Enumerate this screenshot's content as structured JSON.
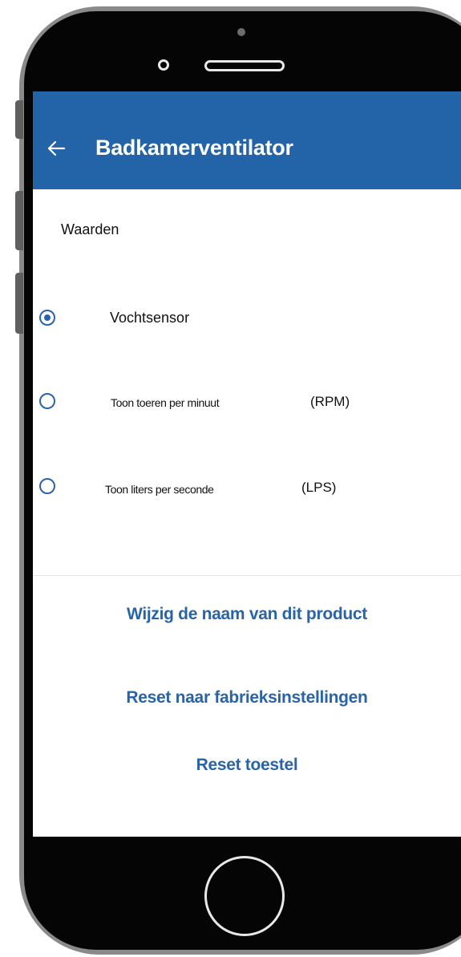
{
  "app_bar": {
    "title": "Badkamerventilator",
    "back_icon": "arrow-left-icon",
    "color": "#2363a8"
  },
  "settings": {
    "section_label": "Waarden",
    "options": [
      {
        "label": "Vochtsensor",
        "suffix": "",
        "selected": true
      },
      {
        "label": "Toon toeren per minuut",
        "suffix": "(RPM)",
        "selected": false
      },
      {
        "label": "Toon liters per seconde",
        "suffix": "(LPS)",
        "selected": false
      }
    ],
    "accent_color": "#2a64a8"
  },
  "actions": {
    "rename": "Wijzig de naam van dit product",
    "factory_reset": "Reset naar fabrieksinstellingen",
    "reset_device": "Reset toestel"
  }
}
